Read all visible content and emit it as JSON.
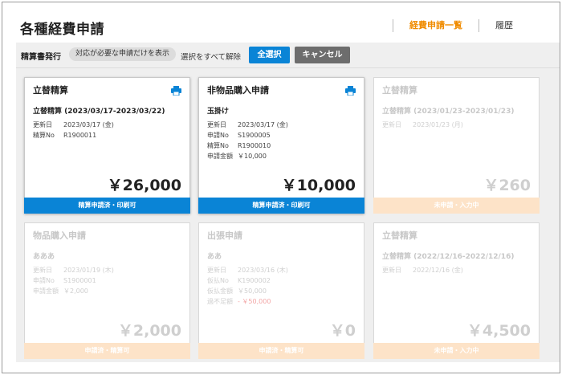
{
  "header": {
    "title": "各種経費申請",
    "nav": [
      {
        "label": "経費申請一覧",
        "active": true
      },
      {
        "label": "履歴",
        "active": false
      }
    ]
  },
  "toolbar": {
    "label": "精算書発行",
    "filter_label": "対応が必要な申請だけを表示",
    "clear_label": "選択をすべて解除",
    "select_all_label": "全選択",
    "cancel_label": "キャンセル"
  },
  "colors": {
    "accent_orange": "#f08c00",
    "primary_blue": "#0a84d6",
    "status_peach": "#fde3c8"
  },
  "cards": [
    {
      "type": "立替精算",
      "title": "立替精算 (2023/03/17-2023/03/22)",
      "rows": [
        {
          "k": "更新日",
          "v": "2023/03/17 (金)"
        },
        {
          "k": "精算No",
          "v": "R1900011"
        }
      ],
      "amount": "￥26,000",
      "status": "精算申請済・印刷可",
      "printable": true
    },
    {
      "type": "非物品購入申請",
      "title": "玉掛け",
      "rows": [
        {
          "k": "更新日",
          "v": "2023/03/17 (金)"
        },
        {
          "k": "申請No",
          "v": "S1900005"
        },
        {
          "k": "精算No",
          "v": "R1900010"
        },
        {
          "k": "申請金額",
          "v": "￥10,000"
        }
      ],
      "amount": "￥10,000",
      "status": "精算申請済・印刷可",
      "printable": true
    },
    {
      "type": "立替精算",
      "title": "立替精算 (2023/01/23-2023/01/23)",
      "rows": [
        {
          "k": "更新日",
          "v": "2023/01/23 (月)"
        }
      ],
      "amount": "￥260",
      "status": "未申請・入力中",
      "printable": false
    },
    {
      "type": "物品購入申請",
      "title": "あああ",
      "rows": [
        {
          "k": "更新日",
          "v": "2023/01/19 (木)"
        },
        {
          "k": "申請No",
          "v": "S1900001"
        },
        {
          "k": "申請金額",
          "v": "￥2,000"
        }
      ],
      "amount": "￥2,000",
      "status": "申請済・精算可",
      "printable": false
    },
    {
      "type": "出張申請",
      "title": "ああ",
      "rows": [
        {
          "k": "更新日",
          "v": "2023/03/16 (木)"
        },
        {
          "k": "仮払No",
          "v": "K1900002"
        },
        {
          "k": "仮払金額",
          "v": "￥50,000"
        },
        {
          "k": "過不足額",
          "v": "- ￥50,000",
          "neg": true
        }
      ],
      "amount": "￥0",
      "status": "申請済・精算可",
      "printable": false
    },
    {
      "type": "立替精算",
      "title": "立替精算 (2022/12/16-2022/12/16)",
      "rows": [
        {
          "k": "更新日",
          "v": "2022/12/16 (金)"
        }
      ],
      "amount": "￥4,500",
      "status": "未申請・入力中",
      "printable": false
    }
  ]
}
